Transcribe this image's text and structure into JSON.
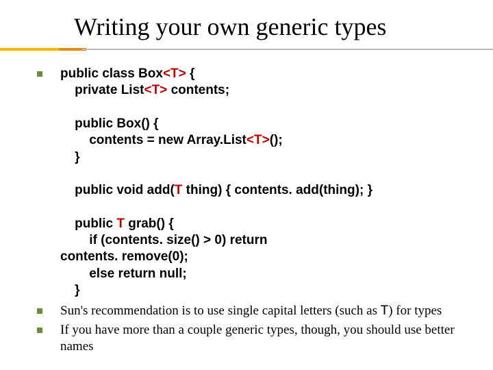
{
  "title": "Writing your own generic types",
  "code": {
    "l1a": "public class Box",
    "l1b": "<T>",
    "l1c": " {",
    "l2a": "    private List",
    "l2b": "<T>",
    "l2c": " contents;",
    "l3": "",
    "l4": "    public Box() {",
    "l5a": "        contents = new Array.List",
    "l5b": "<T>",
    "l5c": "();",
    "l6": "    }",
    "l7": "",
    "l8a": "    public void add(",
    "l8b": "T",
    "l8c": " thing) { contents. add(thing); }",
    "l9": "",
    "l10a": "    public ",
    "l10b": "T",
    "l10c": " grab() {",
    "l11": "        if (contents. size() > 0) return",
    "l12": "contents. remove(0);",
    "l13": "        else return null;",
    "l14": "    }"
  },
  "notes": {
    "n1a": "Sun's recommendation is to use single capital letters (such as ",
    "n1b": "T",
    "n1c": ") for types",
    "n2": "If you have more than a couple generic types, though, you should use better names"
  }
}
